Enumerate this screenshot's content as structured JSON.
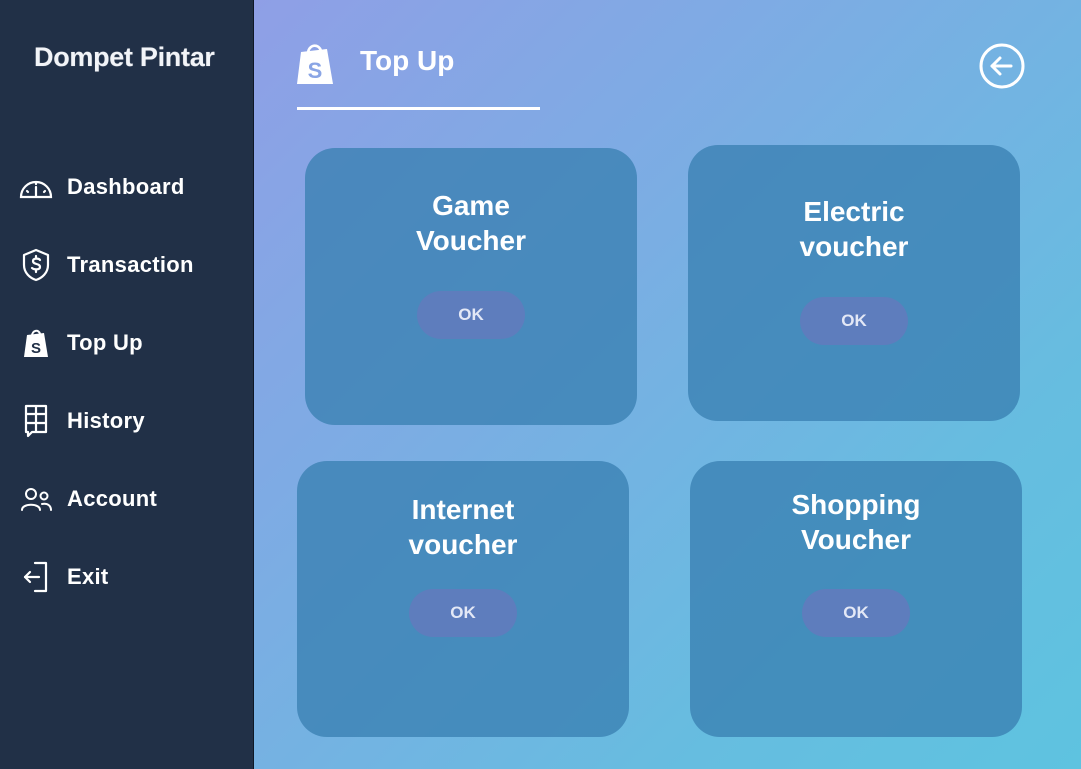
{
  "app": {
    "brand": "Dompet Pintar"
  },
  "sidebar": {
    "items": [
      {
        "label": "Dashboard",
        "icon": "gauge-icon"
      },
      {
        "label": "Transaction",
        "icon": "shield-dollar-icon"
      },
      {
        "label": "Top Up",
        "icon": "shopify-bag-icon"
      },
      {
        "label": "History",
        "icon": "receipt-icon"
      },
      {
        "label": "Account",
        "icon": "users-icon"
      },
      {
        "label": "Exit",
        "icon": "exit-icon"
      }
    ]
  },
  "header": {
    "title": "Top Up",
    "icon": "shopify-bag-icon",
    "back_icon": "arrow-left-circle-icon"
  },
  "cards": [
    {
      "title": "Game\nVoucher",
      "button": "OK"
    },
    {
      "title": "Electric\nvoucher",
      "button": "OK"
    },
    {
      "title": "Internet\nvoucher",
      "button": "OK"
    },
    {
      "title": "Shopping\nVoucher",
      "button": "OK"
    }
  ],
  "colors": {
    "sidebar_bg": "#213047",
    "card_bg": "#3a80b2",
    "button_bg": "#5e7dbd",
    "gradient_start": "#8f9fe6",
    "gradient_end": "#5ec3e0"
  }
}
